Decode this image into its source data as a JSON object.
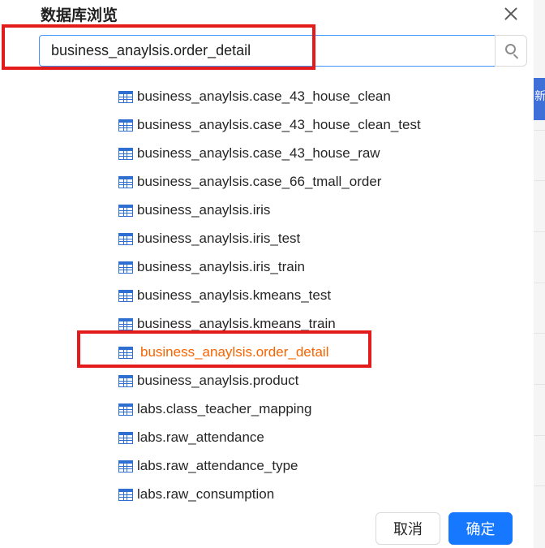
{
  "dialog": {
    "title": "数据库浏览"
  },
  "search": {
    "value": "business_anaylsis.order_detail"
  },
  "tree": {
    "items": [
      {
        "label": "business_anaylsis.case_43_house_clean",
        "selected": false
      },
      {
        "label": "business_anaylsis.case_43_house_clean_test",
        "selected": false
      },
      {
        "label": "business_anaylsis.case_43_house_raw",
        "selected": false
      },
      {
        "label": "business_anaylsis.case_66_tmall_order",
        "selected": false
      },
      {
        "label": "business_anaylsis.iris",
        "selected": false
      },
      {
        "label": "business_anaylsis.iris_test",
        "selected": false
      },
      {
        "label": "business_anaylsis.iris_train",
        "selected": false
      },
      {
        "label": "business_anaylsis.kmeans_test",
        "selected": false
      },
      {
        "label": "business_anaylsis.kmeans_train",
        "selected": false
      },
      {
        "label": "business_anaylsis.order_detail",
        "selected": true
      },
      {
        "label": "business_anaylsis.product",
        "selected": false
      },
      {
        "label": "labs.class_teacher_mapping",
        "selected": false
      },
      {
        "label": "labs.raw_attendance",
        "selected": false
      },
      {
        "label": "labs.raw_attendance_type",
        "selected": false
      },
      {
        "label": "labs.raw_consumption",
        "selected": false
      }
    ]
  },
  "footer": {
    "cancel_label": "取消",
    "ok_label": "确定"
  },
  "background": {
    "tab_label": "新"
  },
  "colors": {
    "accent": "#1677ff",
    "selected_text": "#fa6400",
    "annotation": "#e31b1b",
    "table_icon": "#2f6fd1"
  }
}
